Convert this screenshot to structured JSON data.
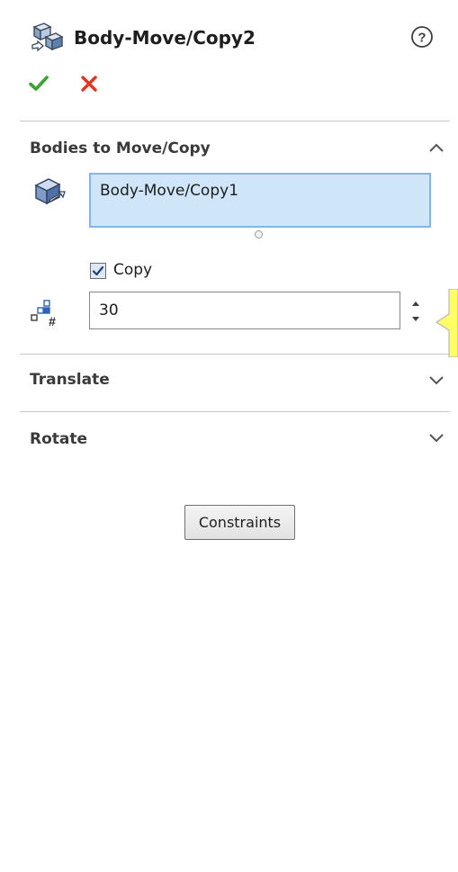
{
  "header": {
    "feature_icon": "move-copy-bodies-icon",
    "title": "Body-Move/Copy2",
    "help_icon": "help-icon"
  },
  "actions": {
    "ok_icon": "checkmark-icon",
    "ok_color": "#3aa235",
    "cancel_icon": "close-icon",
    "cancel_color": "#e0351f"
  },
  "sections": {
    "bodies": {
      "title": "Bodies to Move/Copy",
      "expanded": true,
      "selection_icon": "solid-body-icon",
      "selected_items": [
        "Body-Move/Copy1"
      ],
      "selection_box_color": "#cfe5f8",
      "copy_label": "Copy",
      "copy_checked": true,
      "count_icon": "pattern-count-icon",
      "count_value": "30"
    },
    "translate": {
      "title": "Translate",
      "expanded": false
    },
    "rotate": {
      "title": "Rotate",
      "expanded": false
    }
  },
  "constraints_button": "Constraints",
  "tooltip_accent": "#ffff66"
}
